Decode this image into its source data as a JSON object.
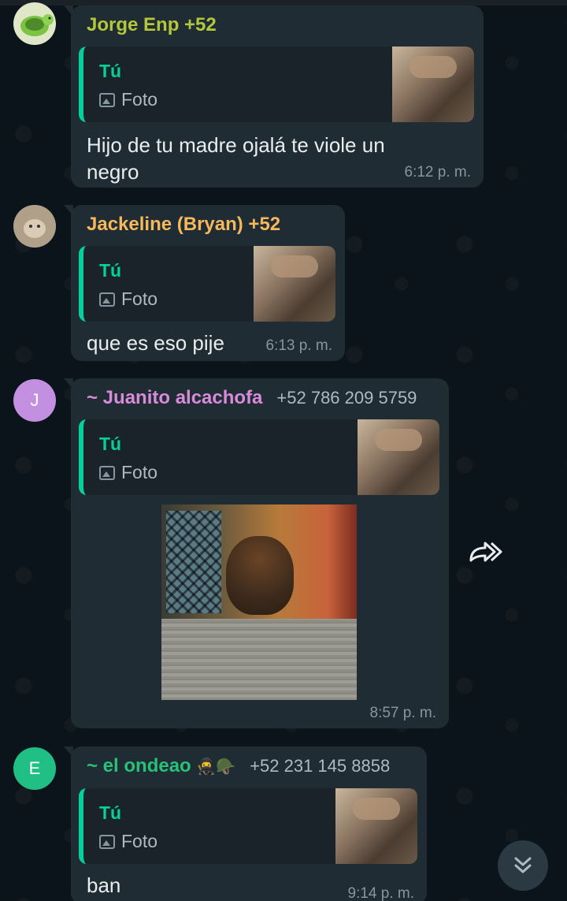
{
  "messages": [
    {
      "sender": "Jorge Enp +52",
      "sender_color": "#b4c73a",
      "avatar": "turtle-avatar",
      "quote_author": "Tú",
      "quote_type": "Foto",
      "text_lines": [
        "Hijo de tu madre ojalá te viole un",
        "negro"
      ],
      "time": "6:12 p. m."
    },
    {
      "sender": "Jackeline (Bryan) +52",
      "sender_color": "#f5b85c",
      "avatar": "cat-avatar",
      "quote_author": "Tú",
      "quote_type": "Foto",
      "text_lines": [
        "que es eso pije"
      ],
      "time": "6:13 p. m."
    },
    {
      "sender": "~ Juanito alcachofa",
      "sender_color": "#d88bd9",
      "phone": "+52 786 209 5759",
      "avatar_letter": "J",
      "avatar_color": "#c38fe0",
      "quote_author": "Tú",
      "quote_type": "Foto",
      "has_photo": true,
      "time": "8:57 p. m."
    },
    {
      "sender": "~ el ondeao",
      "sender_emojis": "🥷🪖",
      "sender_color": "#27c17a",
      "phone": "+52 231 145 8858",
      "avatar_letter": "E",
      "avatar_color": "#1fbf85",
      "quote_author": "Tú",
      "quote_type": "Foto",
      "text_lines": [
        "ban"
      ],
      "time": "9:14 p. m."
    }
  ],
  "icons": {
    "forward": "forward-icon",
    "scroll_down": "double-chevron-down-icon",
    "image": "image-icon"
  }
}
